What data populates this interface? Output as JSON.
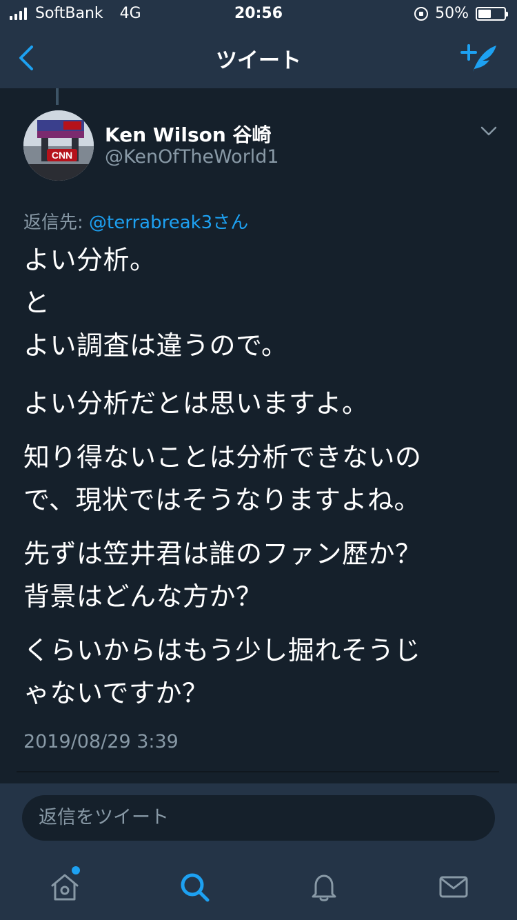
{
  "status_bar": {
    "carrier": "SoftBank",
    "network": "4G",
    "time": "20:56",
    "battery": "50%",
    "battery_level": 0.5
  },
  "nav": {
    "title": "ツイート",
    "back_icon": "chevron-left-icon",
    "compose_icon": "compose-tweet-icon"
  },
  "tweet": {
    "author_name": "Ken Wilson 谷崎",
    "author_handle": "@KenOfTheWorld1",
    "avatar_text": "CNN",
    "reply_label": "返信先: ",
    "reply_mention": "@terrabreak3さん",
    "paragraphs": [
      [
        "よい分析。",
        "と",
        "よい調査は違うので。"
      ],
      [
        "よい分析だとは思いますよ。"
      ],
      [
        "知り得ないことは分析できないの",
        "で、現状ではそうなりますよね。"
      ],
      [
        "先ずは笠井君は誰のファン歴か？",
        "背景はどんな方か？"
      ],
      [
        "くらいからはもう少し掘れそうじ",
        "ゃないですか？"
      ]
    ],
    "timestamp": "2019/08/29 3:39"
  },
  "reply_box": {
    "placeholder": "返信をツイート"
  },
  "tabbar": {
    "items": [
      "home-icon",
      "search-icon",
      "notifications-icon",
      "messages-icon"
    ],
    "accent": "#1da1f2"
  },
  "colors": {
    "background": "#15202b",
    "bar": "#243447",
    "secondary_text": "#8899a6",
    "link": "#1da1f2"
  }
}
